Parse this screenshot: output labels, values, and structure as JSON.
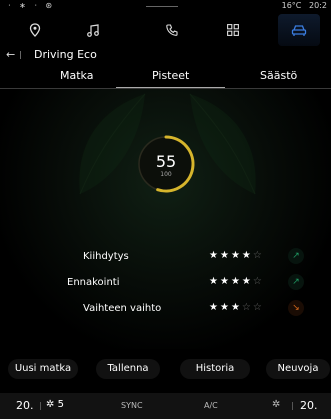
{
  "status_bar": {
    "left_icons": "⋅ ∗ ⋅ ⊛",
    "temperature": "16°C",
    "time": "20:2"
  },
  "nav": {
    "items": [
      {
        "icon": "location-icon"
      },
      {
        "icon": "music-icon"
      },
      {
        "icon": "phone-icon"
      },
      {
        "icon": "apps-icon"
      },
      {
        "icon": "car-icon",
        "active": true
      }
    ]
  },
  "header": {
    "back": "←",
    "title": "Driving Eco"
  },
  "tabs": [
    {
      "label": "Matka"
    },
    {
      "label": "Pisteet",
      "active": true
    },
    {
      "label": "Säästö"
    }
  ],
  "score": {
    "value": "55",
    "max": "100",
    "level": 0.55,
    "color": "#d6b52c"
  },
  "ratings": [
    {
      "label": "Kiihdytys",
      "stars": 4,
      "total": 5,
      "trend": "up",
      "trend_glyph": "↗"
    },
    {
      "label": "Ennakointi",
      "stars": 4,
      "total": 5,
      "trend": "up",
      "trend_glyph": "↗"
    },
    {
      "label": "Vaihteen vaihto",
      "stars": 3,
      "total": 5,
      "trend": "down",
      "trend_glyph": "↘"
    }
  ],
  "actions": {
    "new_trip": "Uusi matka",
    "save": "Tallenna",
    "history": "Historia",
    "advice": "Neuvoja"
  },
  "climate": {
    "left_temp": "20.",
    "fan": "5",
    "sync": "SYNC",
    "ac": "A/C",
    "right_temp": "20."
  },
  "colors": {
    "trend_up": "#1f9a63",
    "trend_down": "#d96a1c",
    "gauge": "#d6b52c",
    "active_tab_underline": "#aaaaaa"
  }
}
